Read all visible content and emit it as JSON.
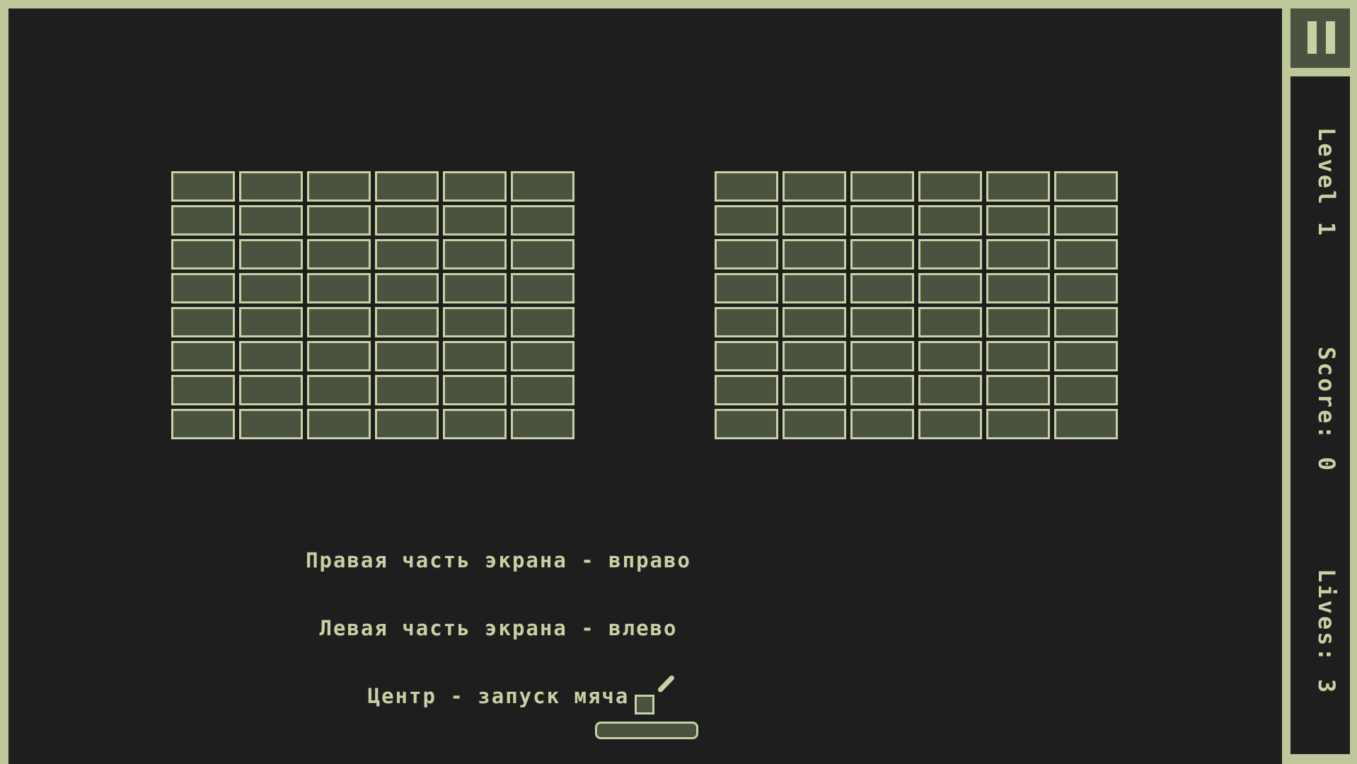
{
  "instructions": {
    "line1": "Правая часть экрана - вправо",
    "line2": "Левая часть экрана - влево",
    "line3": "Центр - запуск мяча"
  },
  "hud": {
    "level_text": "Level 1",
    "score_text": "Score: 0",
    "lives_text": "Lives: 3",
    "pause_icon": "pause-icon"
  },
  "bricks": {
    "left_grid": {
      "rows": 8,
      "columns": 6
    },
    "right_grid": {
      "rows": 8,
      "columns": 6
    }
  },
  "colors": {
    "background": "#1e1e1e",
    "frame": "#bdc79a",
    "brick_fill": "#4a5240",
    "brick_outline": "#c7d1a3",
    "text": "#c7d1a3"
  }
}
